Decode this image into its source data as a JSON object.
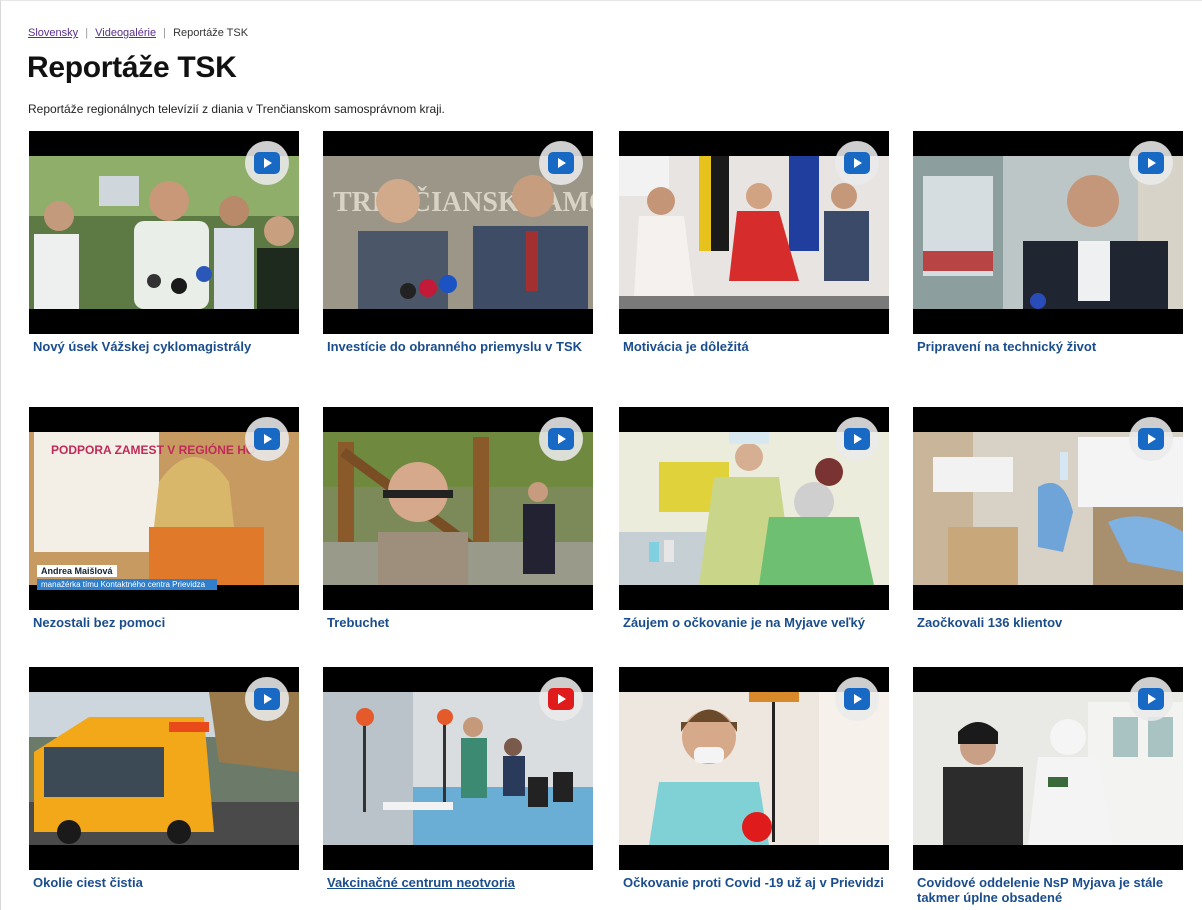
{
  "breadcrumb": {
    "items": [
      "Slovensky",
      "Videogalérie",
      "Reportáže TSK"
    ],
    "separator": "|"
  },
  "page": {
    "title": "Reportáže TSK",
    "subtitle": "Reportáže regionálnych televízií z diania v Trenčianskom samosprávnom kraji."
  },
  "colors": {
    "link": "#1a4d8c",
    "breadcrumb_link": "#5a2e8a",
    "play_blue": "#1769c4",
    "play_red": "#e01b1b"
  },
  "videos": [
    {
      "title": "Nový úsek Vážskej cyklomagistrály",
      "icon": "play-blue-icon"
    },
    {
      "title": "Investície do obranného priemyslu v TSK",
      "icon": "play-blue-icon",
      "overlay_text": "TRENČIANSK SAMOSPR"
    },
    {
      "title": "Motivácia je dôležitá",
      "icon": "play-blue-icon"
    },
    {
      "title": "Pripravení na technický život",
      "icon": "play-blue-icon"
    },
    {
      "title": "Nezostali bez pomoci",
      "icon": "play-blue-icon",
      "overlay_text": "PODPORA ZAMEST V REGIÓNE HO",
      "lower_third": {
        "name": "Andrea Maišlová",
        "role": "manažérka tímu Kontaktného centra Prievidza"
      }
    },
    {
      "title": "Trebuchet",
      "icon": "play-blue-icon"
    },
    {
      "title": "Záujem o očkovanie je na Myjave veľký",
      "icon": "play-blue-icon"
    },
    {
      "title": "Zaočkovali 136 klientov",
      "icon": "play-blue-icon"
    },
    {
      "title": "Okolie ciest čistia",
      "icon": "play-blue-icon"
    },
    {
      "title": "Vakcinačné centrum neotvoria",
      "icon": "play-red-icon",
      "underlined": true
    },
    {
      "title": "Očkovanie proti Covid -19 už aj v Prievidzi",
      "icon": "play-blue-icon"
    },
    {
      "title": "Covidové oddelenie NsP Myjava je stále takmer úplne obsadené",
      "icon": "play-blue-icon"
    }
  ]
}
